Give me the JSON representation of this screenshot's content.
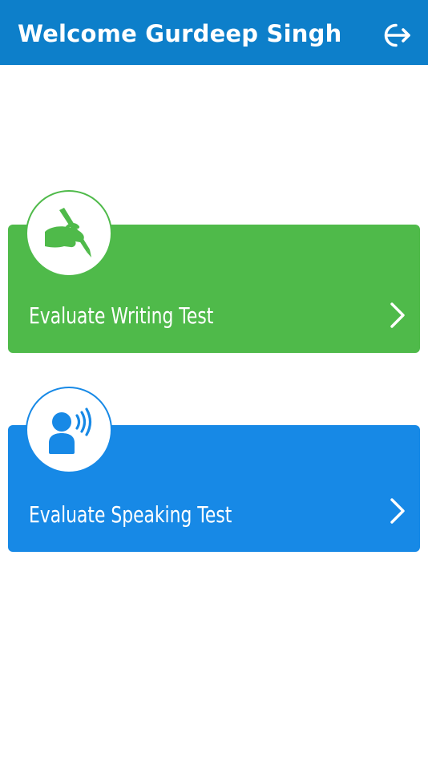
{
  "header": {
    "title": "Welcome Gurdeep Singh",
    "logout_icon": "logout-icon"
  },
  "cards": [
    {
      "label": "Evaluate Writing Test",
      "icon": "writing-hand-icon",
      "color": "#4fba4a"
    },
    {
      "label": "Evaluate Speaking Test",
      "icon": "speaking-person-icon",
      "color": "#1789e6"
    }
  ],
  "colors": {
    "header_bg": "#0d7fca",
    "writing": "#4fba4a",
    "speaking": "#1789e6",
    "text_on_color": "#ffffff"
  }
}
